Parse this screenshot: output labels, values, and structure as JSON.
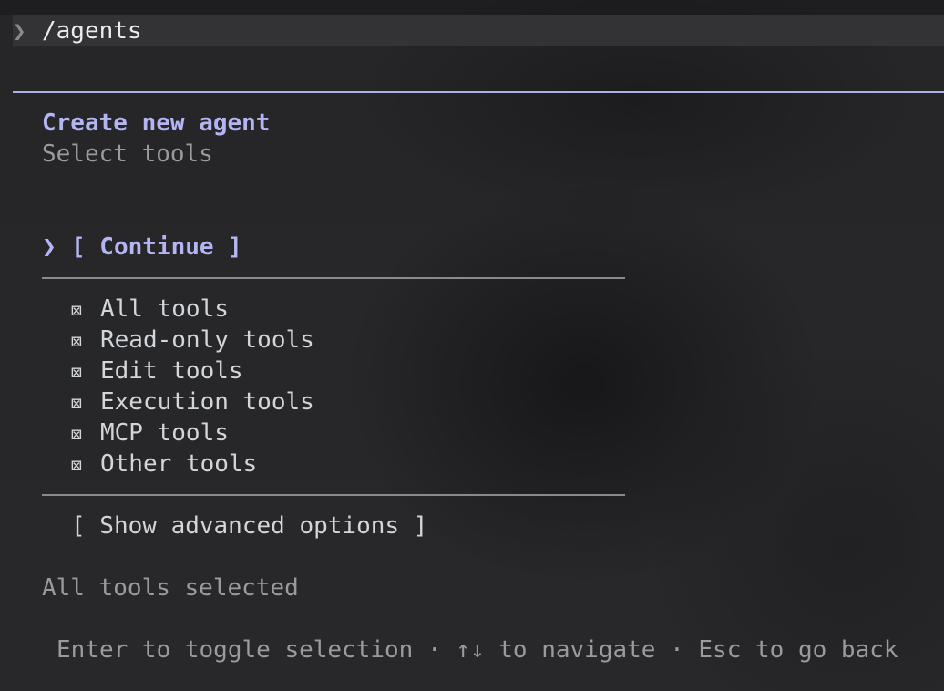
{
  "prompt": {
    "chevron": "❯",
    "command": "/agents"
  },
  "wizard": {
    "title": "Create new agent",
    "subtitle": "Select tools",
    "continue_chevron": "❯",
    "continue_label": "[ Continue ]",
    "checkbox_glyph": "⊠",
    "tools": [
      {
        "label": "All tools",
        "checked": true
      },
      {
        "label": "Read-only tools",
        "checked": true
      },
      {
        "label": "Edit tools",
        "checked": true
      },
      {
        "label": "Execution tools",
        "checked": true
      },
      {
        "label": "MCP tools",
        "checked": true
      },
      {
        "label": "Other tools",
        "checked": true
      }
    ],
    "advanced_label": "[ Show advanced options ]",
    "status": "All tools selected",
    "help": "Enter to toggle selection · ↑↓ to navigate · Esc to go back"
  },
  "colors": {
    "accent": "#b3b6f2",
    "text": "#d2d6da",
    "muted": "#9a9b9e",
    "background": "#252527"
  }
}
